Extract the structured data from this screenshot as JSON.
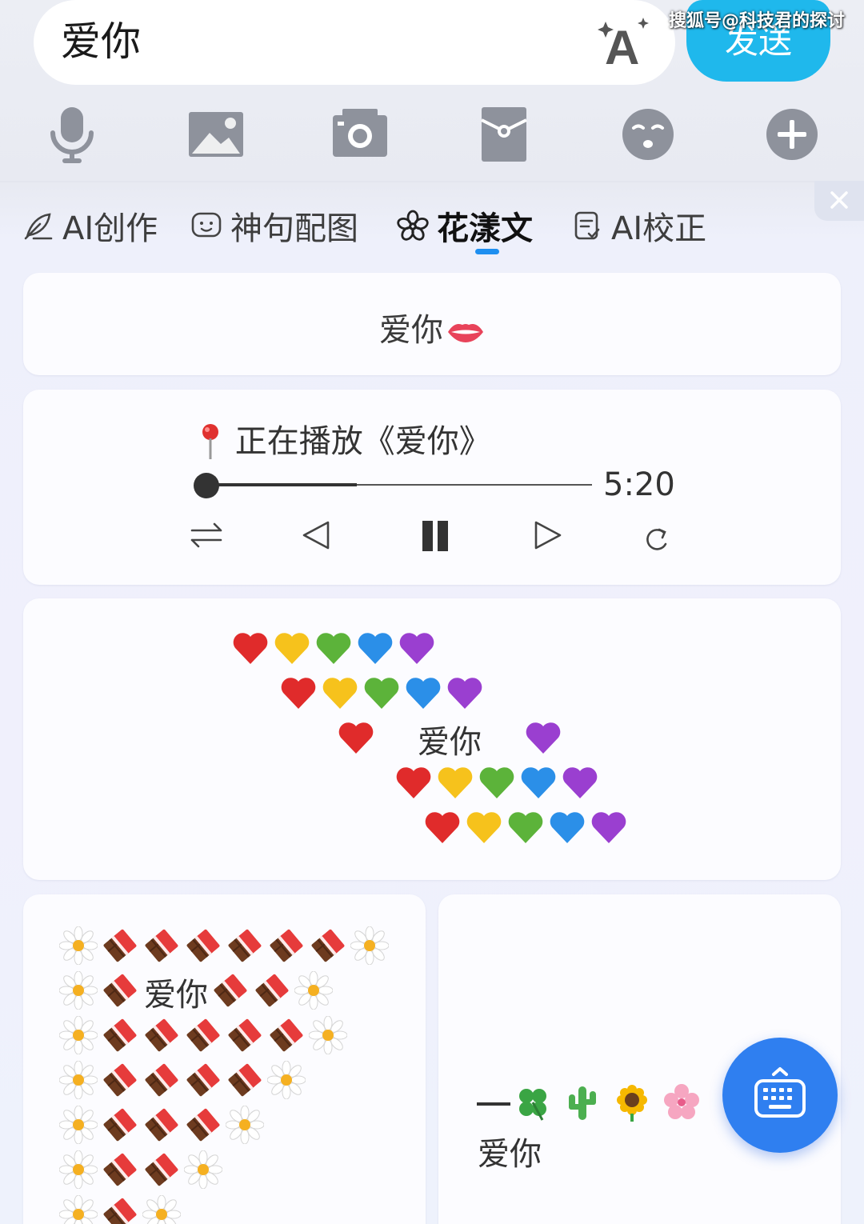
{
  "input": {
    "value": "爱你",
    "send_label": "发送"
  },
  "watermark": "搜狐号@科技君的探讨",
  "toolbar": {
    "items": [
      "microphone-icon",
      "image-icon",
      "camera-icon",
      "red-packet-icon",
      "emoji-face-icon",
      "plus-icon"
    ]
  },
  "tabs": [
    {
      "label": "AI创作",
      "icon": "leaf-pen-icon",
      "active": false
    },
    {
      "label": "神句配图",
      "icon": "chat-face-icon",
      "active": false
    },
    {
      "label": "花漾文",
      "icon": "flower-icon",
      "active": true
    },
    {
      "label": "AI校正",
      "icon": "document-check-icon",
      "active": false
    }
  ],
  "cards": {
    "lips": {
      "text": "爱你"
    },
    "music": {
      "title": "正在播放《爱你》",
      "time": "5:20",
      "progress": 0.39
    },
    "hearts": {
      "center_text": "爱你"
    },
    "chocolate": {
      "center_text": "爱你"
    },
    "plants": {
      "text": "爱你"
    }
  },
  "colors": {
    "accent": "#1e8ff0",
    "send": "#1fb8ec",
    "fab": "#2f7ff0"
  }
}
